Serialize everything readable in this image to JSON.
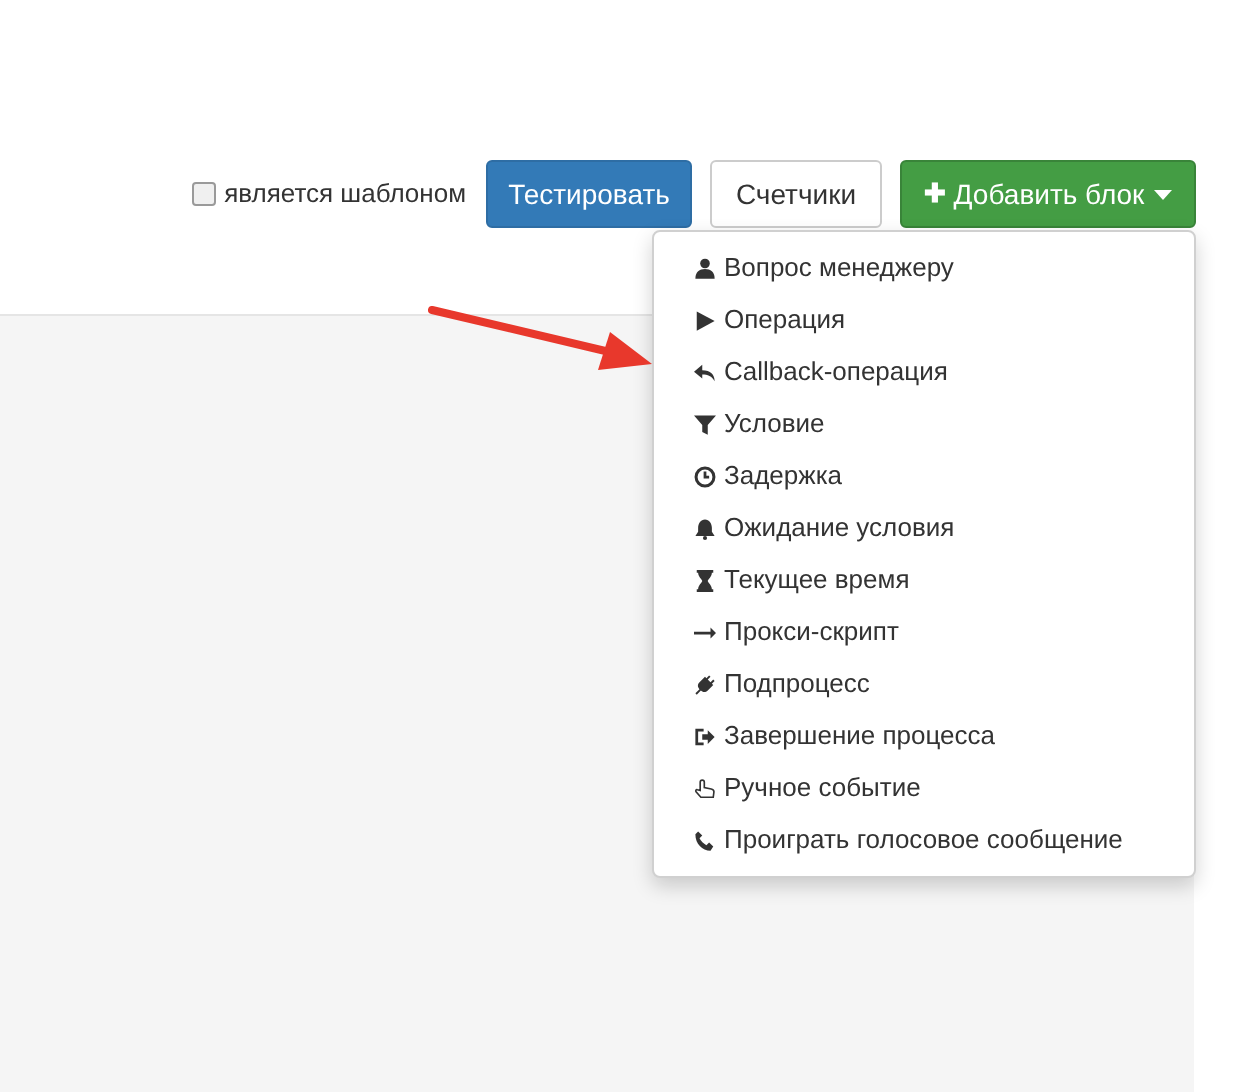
{
  "toolbar": {
    "template_checkbox": {
      "label": "является шаблоном",
      "checked": false
    },
    "buttons": [
      {
        "label": "Тестировать",
        "kind": "primary"
      },
      {
        "label": "Счетчики",
        "kind": "default"
      },
      {
        "label": "Добавить блок",
        "kind": "success",
        "icon_text": "✚",
        "caret": true
      }
    ]
  },
  "dropdown": {
    "items": [
      {
        "label": "Вопрос менеджеру"
      },
      {
        "label": "Операция"
      },
      {
        "label": "Callback-операция"
      },
      {
        "label": "Условие"
      },
      {
        "label": "Задержка"
      },
      {
        "label": "Ожидание условия"
      },
      {
        "label": "Текущее время"
      },
      {
        "label": "Прокси-скрипт"
      },
      {
        "label": "Подпроцесс"
      },
      {
        "label": "Завершение процесса"
      },
      {
        "label": "Ручное событие"
      },
      {
        "label": "Проиграть голосовое сообщение"
      }
    ]
  }
}
